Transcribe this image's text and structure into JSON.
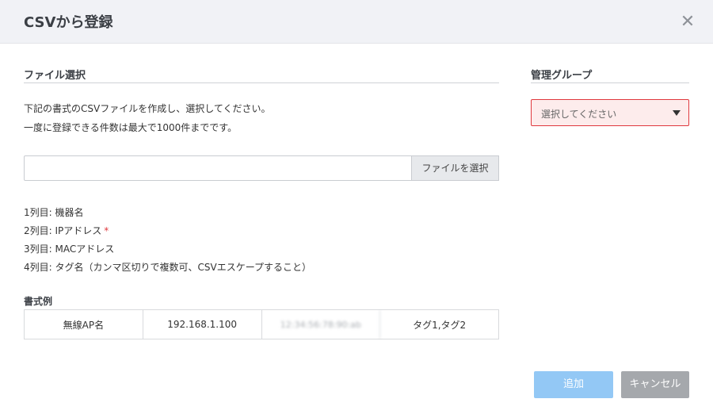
{
  "dialog": {
    "title": "CSVから登録",
    "close_icon": "close-icon"
  },
  "file_section": {
    "title": "ファイル選択",
    "description_lines": [
      "下記の書式のCSVファイルを作成し、選択してください。",
      "一度に登録できる件数は最大で1000件までです。"
    ],
    "file_input_value": "",
    "choose_file_label": "ファイルを選択"
  },
  "columns": [
    {
      "text": "1列目: 機器名",
      "required": false
    },
    {
      "text": "2列目: IPアドレス",
      "required": true
    },
    {
      "text": "3列目: MACアドレス",
      "required": false
    },
    {
      "text": "4列目: タグ名（カンマ区切りで複数可、CSVエスケープすること）",
      "required": false
    }
  ],
  "required_mark": "*",
  "example": {
    "title": "書式例",
    "cells": [
      "無線AP名",
      "192.168.1.100",
      "12:34:56:78:90:ab",
      "タグ1,タグ2"
    ]
  },
  "group_section": {
    "title": "管理グループ",
    "select_placeholder": "選択してください",
    "colors": {
      "error_border": "#e0393e",
      "error_bg": "#fdecec"
    }
  },
  "buttons": {
    "add_label": "追加",
    "cancel_label": "キャンセル",
    "add_color": "#93c8f5",
    "cancel_color": "#a5a8ac"
  }
}
